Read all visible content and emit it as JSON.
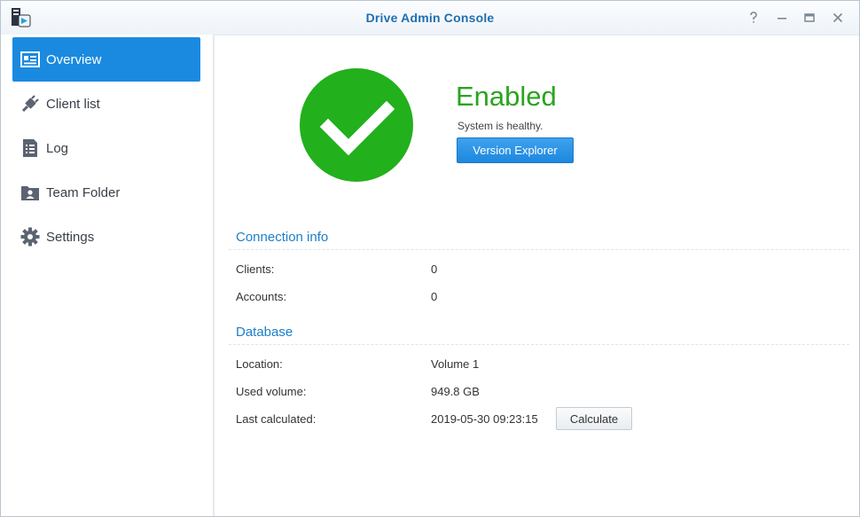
{
  "window": {
    "title": "Drive Admin Console",
    "controls": {
      "help": "?",
      "minimize": "—",
      "maximize": "▭",
      "close": "✕"
    }
  },
  "sidebar": {
    "items": [
      {
        "label": "Overview",
        "icon": "overview-card-icon",
        "active": true
      },
      {
        "label": "Client list",
        "icon": "plug-icon",
        "active": false
      },
      {
        "label": "Log",
        "icon": "log-list-icon",
        "active": false
      },
      {
        "label": "Team Folder",
        "icon": "team-folder-icon",
        "active": false
      },
      {
        "label": "Settings",
        "icon": "gear-icon",
        "active": false
      }
    ]
  },
  "status": {
    "title": "Enabled",
    "subtitle": "System is healthy.",
    "icon": "checkmark-icon",
    "color": "#22b01c",
    "version_explorer_label": "Version Explorer"
  },
  "connection_info": {
    "title": "Connection info",
    "rows": [
      {
        "label": "Clients:",
        "value": "0"
      },
      {
        "label": "Accounts:",
        "value": "0"
      }
    ]
  },
  "database": {
    "title": "Database",
    "rows": [
      {
        "label": "Location:",
        "value": "Volume 1"
      },
      {
        "label": "Used volume:",
        "value": "949.8 GB"
      },
      {
        "label": "Last calculated:",
        "value": "2019-05-30 09:23:15"
      }
    ],
    "calculate_label": "Calculate"
  },
  "colors": {
    "accent": "#1a8ae0",
    "section_title": "#1b7fc9",
    "enabled_text": "#2aa41f"
  }
}
